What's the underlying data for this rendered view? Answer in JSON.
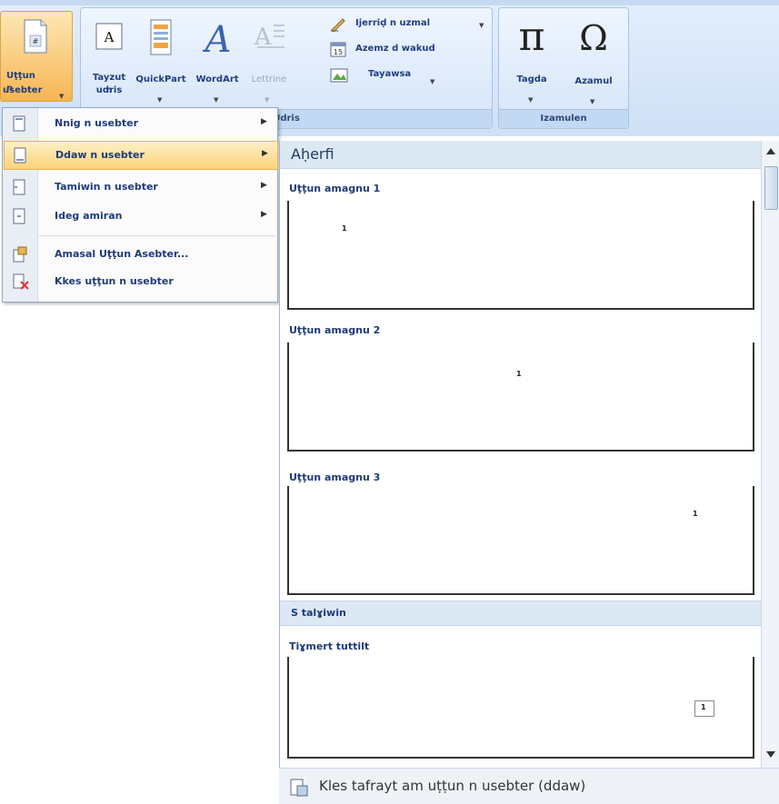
{
  "ribbon": {
    "page_number_button": {
      "line1": "Uṭṭun n",
      "line2": "usebter"
    },
    "text_group": {
      "text_box": {
        "line1": "Tayzut n",
        "line2": "udris"
      },
      "quickpart": "QuickPart",
      "wordart": "WordArt",
      "dropcap": "Lettrine",
      "signature_line": "Ijerriḍ n uzmal",
      "date_time": "Azemz d wakud",
      "object": "Tayawsa",
      "group_label": "Udris"
    },
    "symbols_group": {
      "equation": "Tagda",
      "symbol": "Azamul",
      "group_label": "Izamulen"
    }
  },
  "menu": {
    "items": [
      {
        "label": "Nnig n usebter",
        "has_submenu": true
      },
      {
        "label": "Ddaw n usebter",
        "has_submenu": true,
        "highlighted": true
      },
      {
        "label": "Tamiwin n usebter",
        "has_submenu": true
      },
      {
        "label": "Ideg amiran",
        "has_submenu": true
      },
      {
        "label": "Amasal Uṭṭun Asebter...",
        "has_submenu": false
      },
      {
        "label": "Kkes uṭṭun n usebter",
        "has_submenu": false
      }
    ]
  },
  "gallery": {
    "header": "Aḥerfi",
    "thumbnails": [
      {
        "label": "Uṭṭun amagnu 1",
        "number": "1"
      },
      {
        "label": "Uṭṭun amagnu 2",
        "number": "1"
      },
      {
        "label": "Uṭṭun amagnu 3",
        "number": "1"
      }
    ],
    "section": "S talɣiwin",
    "tagged": {
      "label": "Tiɣmert tuttilt",
      "number": "1"
    },
    "footer": "Kles tafrayt am uṭṭun n usebter (ddaw)"
  }
}
